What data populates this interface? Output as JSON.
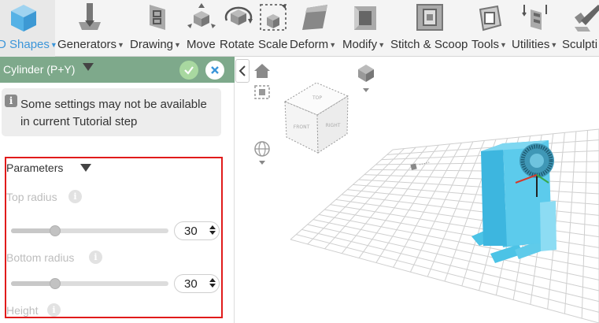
{
  "toolbar": {
    "items": [
      {
        "label": "D Shapes",
        "icon": "cube-icon",
        "active": true
      },
      {
        "label": "Generators",
        "icon": "generator-icon"
      },
      {
        "label": "Drawing",
        "icon": "drawing-icon"
      },
      {
        "label": "Move",
        "icon": "move-icon"
      },
      {
        "label": "Rotate",
        "icon": "rotate-icon"
      },
      {
        "label": "Scale",
        "icon": "scale-icon"
      },
      {
        "label": "Deform",
        "icon": "deform-icon"
      },
      {
        "label": "Modify",
        "icon": "modify-icon"
      },
      {
        "label": "Stitch & Scoop",
        "icon": "stitch-icon"
      },
      {
        "label": "Tools",
        "icon": "tools-icon"
      },
      {
        "label": "Utilities",
        "icon": "utilities-icon"
      },
      {
        "label": "Sculpti",
        "icon": "sculpt-icon"
      }
    ]
  },
  "panel": {
    "title": "Cylinder (P+Y)",
    "note": "Some settings may not be available in current Tutorial step",
    "note_icon": "i",
    "parameters_label": "Parameters",
    "help_icon": "i",
    "fields": [
      {
        "label": "Top radius",
        "value": "30",
        "fraction": 0.28
      },
      {
        "label": "Bottom radius",
        "value": "30",
        "fraction": 0.28
      },
      {
        "label": "Height"
      }
    ]
  },
  "viewcube": {
    "top": "TOP",
    "left": "FRONT",
    "right": "RIGHT"
  },
  "colors": {
    "accent": "#3b95d9",
    "header": "#7ea98b",
    "model": "#4cc3e6",
    "highlight": "#e11b1b"
  }
}
